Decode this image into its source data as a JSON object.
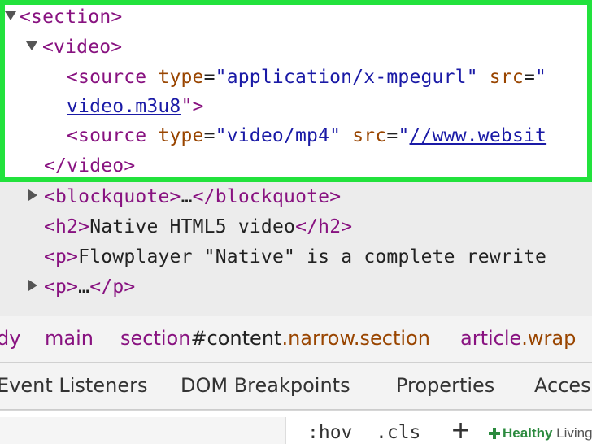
{
  "dom_tree": {
    "section_open": "<section>",
    "video_open": "<video>",
    "source1": {
      "tag_start": "<source ",
      "attr_type": "type",
      "eq1": "=",
      "type_value": "\"application/x-mpegurl\"",
      "attr_src": " src",
      "eq2": "=",
      "src_value_visible": "\"",
      "src_link_cont": "video.m3u8",
      "close": "\">"
    },
    "source2": {
      "tag_start": "<source ",
      "attr_type": "type",
      "eq1": "=",
      "type_value": "\"video/mp4\"",
      "attr_src": " src",
      "eq2": "=",
      "quote": "\"",
      "src_link": "//www.websit"
    },
    "video_close": "</video>",
    "blockquote_open": "<blockquote>",
    "ellipsis1": "…",
    "blockquote_close": "</blockquote>",
    "h2_open": "<h2>",
    "h2_text": "Native HTML5 video",
    "h2_close": "</h2>",
    "p_open": "<p>",
    "p_text": "Flowplayer \"Native\" is a complete rewrite",
    "p2_open": "<p>",
    "ellipsis2": "…",
    "p2_close": "</p>"
  },
  "breadcrumb": {
    "items": [
      {
        "tag": "dy",
        "id": "",
        "cls": ""
      },
      {
        "tag": "main",
        "id": "",
        "cls": ""
      },
      {
        "tag": "section",
        "id": "#content",
        "cls": ".narrow.section"
      },
      {
        "tag": "article",
        "id": "",
        "cls": ".wrap"
      }
    ]
  },
  "tabs": {
    "event_listeners": "Event Listeners",
    "dom_breakpoints": "DOM Breakpoints",
    "properties": "Properties",
    "accessibility": "Acces"
  },
  "toolbar": {
    "hov": ":hov",
    "cls": ".cls",
    "plus": "+"
  },
  "watermark": {
    "brand": "Healthy",
    "suffix": "Living"
  },
  "colors": {
    "highlight_border": "#22e23c",
    "tag": "#881280",
    "attribute": "#994500",
    "value": "#1a1aa6"
  }
}
